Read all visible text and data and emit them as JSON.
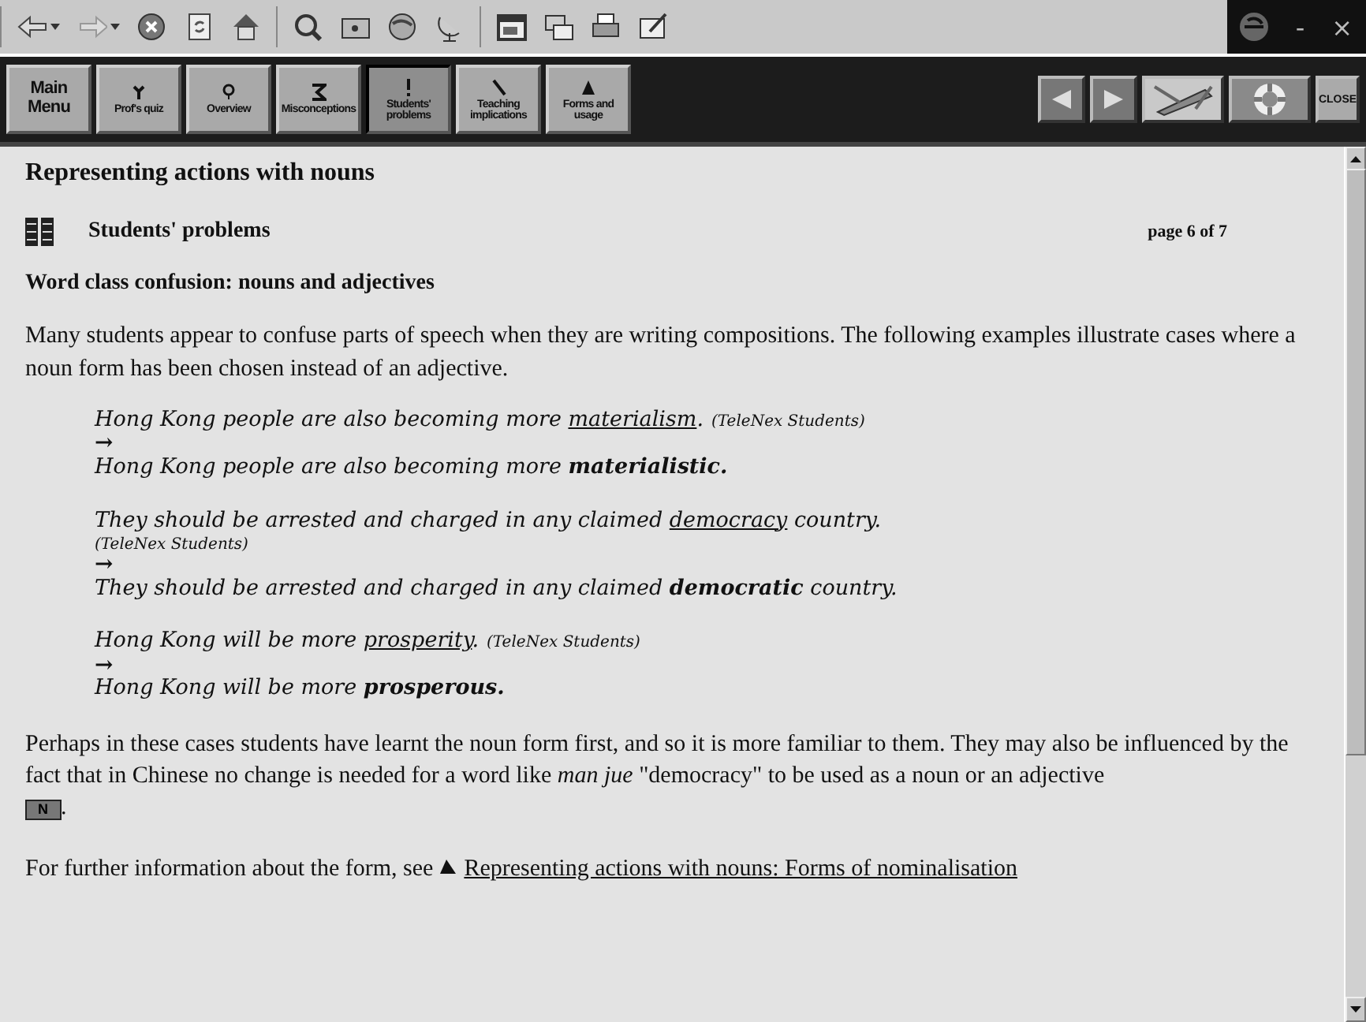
{
  "browser_toolbar": {
    "buttons": [
      {
        "kind": "back",
        "dropdown": true
      },
      {
        "kind": "forward",
        "dropdown": true
      },
      {
        "kind": "stop"
      },
      {
        "kind": "refresh"
      },
      {
        "kind": "home"
      },
      {
        "kind": "search"
      },
      {
        "kind": "folder"
      },
      {
        "kind": "palette"
      },
      {
        "kind": "satellite"
      },
      {
        "kind": "window"
      },
      {
        "kind": "mail"
      },
      {
        "kind": "print"
      },
      {
        "kind": "edit"
      }
    ],
    "window_controls": [
      "-",
      "×"
    ]
  },
  "nav": {
    "sections": [
      {
        "label": "Main Menu",
        "selected": false
      },
      {
        "label": "Prof's quiz",
        "selected": false
      },
      {
        "label": "Overview",
        "selected": false
      },
      {
        "label": "Misconceptions",
        "selected": false
      },
      {
        "label": "Students' problems",
        "selected": true
      },
      {
        "label": "Teaching implications",
        "selected": false
      },
      {
        "label": "Forms and usage",
        "selected": false
      }
    ],
    "tools": [
      {
        "kind": "prev"
      },
      {
        "kind": "next"
      },
      {
        "kind": "pencil"
      },
      {
        "kind": "lifebuoy"
      },
      {
        "kind": "close",
        "label": "CLOSE"
      }
    ]
  },
  "content": {
    "title": "Representing actions with nouns",
    "section": "Students' problems",
    "page": "page 6 of 7",
    "heading": "Word class confusion: nouns and adjectives",
    "intro": "Many students appear to confuse parts of speech when they are writing compositions. The following examples illustrate cases where a noun form has been chosen instead of an adjective.",
    "examples": [
      {
        "before": "Hong Kong people are also becoming more ",
        "error": "materialism",
        "after": ".",
        "source": "(TeleNex Students)",
        "arrow": "→",
        "correction": "Hong Kong people are also becoming more **materialistic.**"
      },
      {
        "before": "They should be arrested and charged in any claimed ",
        "error": "democracy",
        "after": " country.",
        "source": "(TeleNex Students)",
        "arrow": "→",
        "correction": "They should be arrested and charged in any claimed **democratic** country."
      },
      {
        "before": "Hong Kong will be more ",
        "error": "prosperity",
        "after": ".",
        "source": "(TeleNex Students)",
        "arrow": "→",
        "correction": "Hong Kong will be more **prosperous.**"
      }
    ],
    "explanation": "Perhaps in these cases students have learnt the noun form first, and so it is more familiar to them. They may also be influenced by the fact that in Chinese no change is needed for a word like *man jue* \"democracy\" to be used as a noun or an adjective",
    "explanation_badge": "N",
    "explanation_end": ".",
    "further_text": "For further information about the form, see",
    "further_link": "Representing actions with nouns: Forms of nominalisation"
  }
}
